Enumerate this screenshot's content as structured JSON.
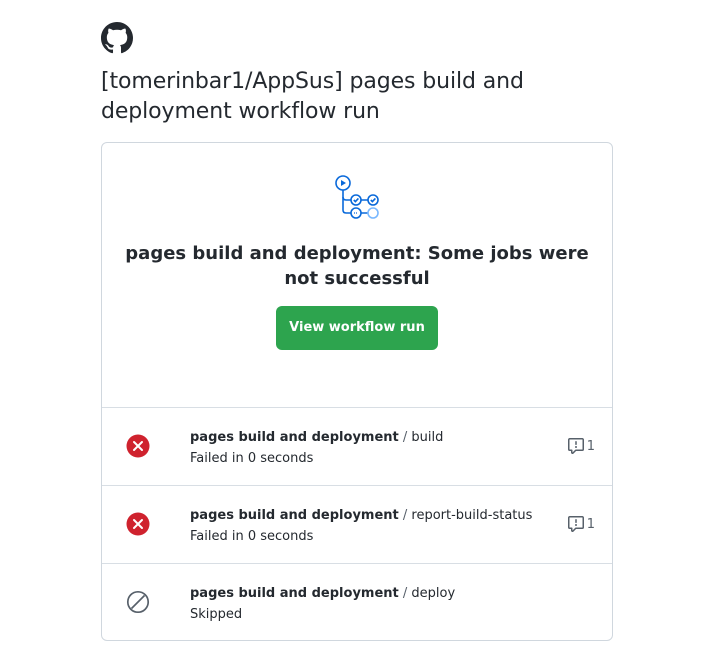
{
  "page": {
    "logo_icon": "github-octocat-icon",
    "title": "[tomerinbar1/AppSus] pages build and deployment workflow run"
  },
  "hero": {
    "icon": "workflow-graph-icon",
    "headline": "pages build and deployment: Some jobs were not successful",
    "button_label": "View workflow run",
    "button_color": "#2da44e"
  },
  "jobs": [
    {
      "status": "failed",
      "status_icon": "x-circle-fill-icon",
      "status_color": "#cf222e",
      "workflow": "pages build and deployment",
      "separator": " / ",
      "name": "build",
      "detail": "Failed in 0 seconds",
      "annotation_icon": "report-icon",
      "annotation_count": "1"
    },
    {
      "status": "failed",
      "status_icon": "x-circle-fill-icon",
      "status_color": "#cf222e",
      "workflow": "pages build and deployment",
      "separator": " / ",
      "name": "report-build-status",
      "detail": "Failed in 0 seconds",
      "annotation_icon": "report-icon",
      "annotation_count": "1"
    },
    {
      "status": "skipped",
      "status_icon": "skip-icon",
      "status_color": "#57606a",
      "workflow": "pages build and deployment",
      "separator": " / ",
      "name": "deploy",
      "detail": "Skipped"
    }
  ]
}
